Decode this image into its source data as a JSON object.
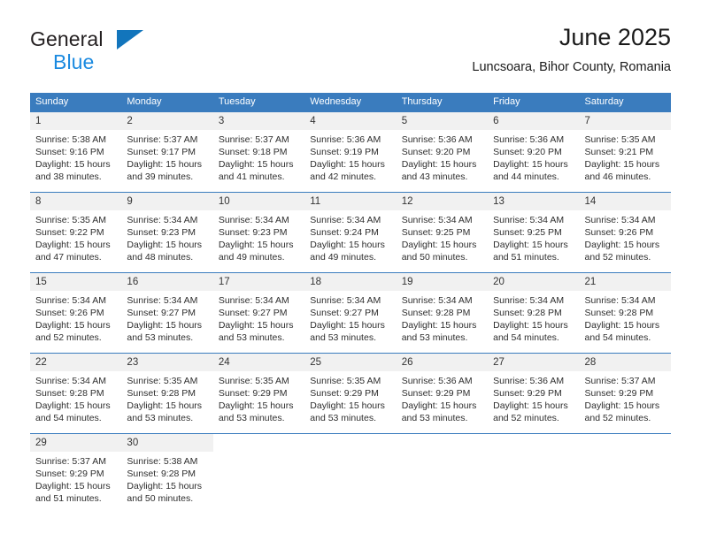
{
  "brand": {
    "name_top": "General",
    "name_bottom": "Blue",
    "triangle_color": "#1275bc",
    "blue_color": "#1b8ae0"
  },
  "header": {
    "title": "June 2025",
    "subtitle": "Luncsoara, Bihor County, Romania"
  },
  "theme": {
    "header_bg": "#3a7cbe",
    "header_text": "#ffffff",
    "daynum_bg": "#f1f1f1",
    "grid_line": "#3a7cbe",
    "body_text": "#2e2e2e"
  },
  "calendar": {
    "weekday_headers": [
      "Sunday",
      "Monday",
      "Tuesday",
      "Wednesday",
      "Thursday",
      "Friday",
      "Saturday"
    ],
    "weeks": [
      [
        {
          "day": "1",
          "sunrise": "Sunrise: 5:38 AM",
          "sunset": "Sunset: 9:16 PM",
          "daylight_1": "Daylight: 15 hours",
          "daylight_2": "and 38 minutes."
        },
        {
          "day": "2",
          "sunrise": "Sunrise: 5:37 AM",
          "sunset": "Sunset: 9:17 PM",
          "daylight_1": "Daylight: 15 hours",
          "daylight_2": "and 39 minutes."
        },
        {
          "day": "3",
          "sunrise": "Sunrise: 5:37 AM",
          "sunset": "Sunset: 9:18 PM",
          "daylight_1": "Daylight: 15 hours",
          "daylight_2": "and 41 minutes."
        },
        {
          "day": "4",
          "sunrise": "Sunrise: 5:36 AM",
          "sunset": "Sunset: 9:19 PM",
          "daylight_1": "Daylight: 15 hours",
          "daylight_2": "and 42 minutes."
        },
        {
          "day": "5",
          "sunrise": "Sunrise: 5:36 AM",
          "sunset": "Sunset: 9:20 PM",
          "daylight_1": "Daylight: 15 hours",
          "daylight_2": "and 43 minutes."
        },
        {
          "day": "6",
          "sunrise": "Sunrise: 5:36 AM",
          "sunset": "Sunset: 9:20 PM",
          "daylight_1": "Daylight: 15 hours",
          "daylight_2": "and 44 minutes."
        },
        {
          "day": "7",
          "sunrise": "Sunrise: 5:35 AM",
          "sunset": "Sunset: 9:21 PM",
          "daylight_1": "Daylight: 15 hours",
          "daylight_2": "and 46 minutes."
        }
      ],
      [
        {
          "day": "8",
          "sunrise": "Sunrise: 5:35 AM",
          "sunset": "Sunset: 9:22 PM",
          "daylight_1": "Daylight: 15 hours",
          "daylight_2": "and 47 minutes."
        },
        {
          "day": "9",
          "sunrise": "Sunrise: 5:34 AM",
          "sunset": "Sunset: 9:23 PM",
          "daylight_1": "Daylight: 15 hours",
          "daylight_2": "and 48 minutes."
        },
        {
          "day": "10",
          "sunrise": "Sunrise: 5:34 AM",
          "sunset": "Sunset: 9:23 PM",
          "daylight_1": "Daylight: 15 hours",
          "daylight_2": "and 49 minutes."
        },
        {
          "day": "11",
          "sunrise": "Sunrise: 5:34 AM",
          "sunset": "Sunset: 9:24 PM",
          "daylight_1": "Daylight: 15 hours",
          "daylight_2": "and 49 minutes."
        },
        {
          "day": "12",
          "sunrise": "Sunrise: 5:34 AM",
          "sunset": "Sunset: 9:25 PM",
          "daylight_1": "Daylight: 15 hours",
          "daylight_2": "and 50 minutes."
        },
        {
          "day": "13",
          "sunrise": "Sunrise: 5:34 AM",
          "sunset": "Sunset: 9:25 PM",
          "daylight_1": "Daylight: 15 hours",
          "daylight_2": "and 51 minutes."
        },
        {
          "day": "14",
          "sunrise": "Sunrise: 5:34 AM",
          "sunset": "Sunset: 9:26 PM",
          "daylight_1": "Daylight: 15 hours",
          "daylight_2": "and 52 minutes."
        }
      ],
      [
        {
          "day": "15",
          "sunrise": "Sunrise: 5:34 AM",
          "sunset": "Sunset: 9:26 PM",
          "daylight_1": "Daylight: 15 hours",
          "daylight_2": "and 52 minutes."
        },
        {
          "day": "16",
          "sunrise": "Sunrise: 5:34 AM",
          "sunset": "Sunset: 9:27 PM",
          "daylight_1": "Daylight: 15 hours",
          "daylight_2": "and 53 minutes."
        },
        {
          "day": "17",
          "sunrise": "Sunrise: 5:34 AM",
          "sunset": "Sunset: 9:27 PM",
          "daylight_1": "Daylight: 15 hours",
          "daylight_2": "and 53 minutes."
        },
        {
          "day": "18",
          "sunrise": "Sunrise: 5:34 AM",
          "sunset": "Sunset: 9:27 PM",
          "daylight_1": "Daylight: 15 hours",
          "daylight_2": "and 53 minutes."
        },
        {
          "day": "19",
          "sunrise": "Sunrise: 5:34 AM",
          "sunset": "Sunset: 9:28 PM",
          "daylight_1": "Daylight: 15 hours",
          "daylight_2": "and 53 minutes."
        },
        {
          "day": "20",
          "sunrise": "Sunrise: 5:34 AM",
          "sunset": "Sunset: 9:28 PM",
          "daylight_1": "Daylight: 15 hours",
          "daylight_2": "and 54 minutes."
        },
        {
          "day": "21",
          "sunrise": "Sunrise: 5:34 AM",
          "sunset": "Sunset: 9:28 PM",
          "daylight_1": "Daylight: 15 hours",
          "daylight_2": "and 54 minutes."
        }
      ],
      [
        {
          "day": "22",
          "sunrise": "Sunrise: 5:34 AM",
          "sunset": "Sunset: 9:28 PM",
          "daylight_1": "Daylight: 15 hours",
          "daylight_2": "and 54 minutes."
        },
        {
          "day": "23",
          "sunrise": "Sunrise: 5:35 AM",
          "sunset": "Sunset: 9:28 PM",
          "daylight_1": "Daylight: 15 hours",
          "daylight_2": "and 53 minutes."
        },
        {
          "day": "24",
          "sunrise": "Sunrise: 5:35 AM",
          "sunset": "Sunset: 9:29 PM",
          "daylight_1": "Daylight: 15 hours",
          "daylight_2": "and 53 minutes."
        },
        {
          "day": "25",
          "sunrise": "Sunrise: 5:35 AM",
          "sunset": "Sunset: 9:29 PM",
          "daylight_1": "Daylight: 15 hours",
          "daylight_2": "and 53 minutes."
        },
        {
          "day": "26",
          "sunrise": "Sunrise: 5:36 AM",
          "sunset": "Sunset: 9:29 PM",
          "daylight_1": "Daylight: 15 hours",
          "daylight_2": "and 53 minutes."
        },
        {
          "day": "27",
          "sunrise": "Sunrise: 5:36 AM",
          "sunset": "Sunset: 9:29 PM",
          "daylight_1": "Daylight: 15 hours",
          "daylight_2": "and 52 minutes."
        },
        {
          "day": "28",
          "sunrise": "Sunrise: 5:37 AM",
          "sunset": "Sunset: 9:29 PM",
          "daylight_1": "Daylight: 15 hours",
          "daylight_2": "and 52 minutes."
        }
      ],
      [
        {
          "day": "29",
          "sunrise": "Sunrise: 5:37 AM",
          "sunset": "Sunset: 9:29 PM",
          "daylight_1": "Daylight: 15 hours",
          "daylight_2": "and 51 minutes."
        },
        {
          "day": "30",
          "sunrise": "Sunrise: 5:38 AM",
          "sunset": "Sunset: 9:28 PM",
          "daylight_1": "Daylight: 15 hours",
          "daylight_2": "and 50 minutes."
        },
        {
          "day": "",
          "sunrise": "",
          "sunset": "",
          "daylight_1": "",
          "daylight_2": ""
        },
        {
          "day": "",
          "sunrise": "",
          "sunset": "",
          "daylight_1": "",
          "daylight_2": ""
        },
        {
          "day": "",
          "sunrise": "",
          "sunset": "",
          "daylight_1": "",
          "daylight_2": ""
        },
        {
          "day": "",
          "sunrise": "",
          "sunset": "",
          "daylight_1": "",
          "daylight_2": ""
        },
        {
          "day": "",
          "sunrise": "",
          "sunset": "",
          "daylight_1": "",
          "daylight_2": ""
        }
      ]
    ]
  }
}
